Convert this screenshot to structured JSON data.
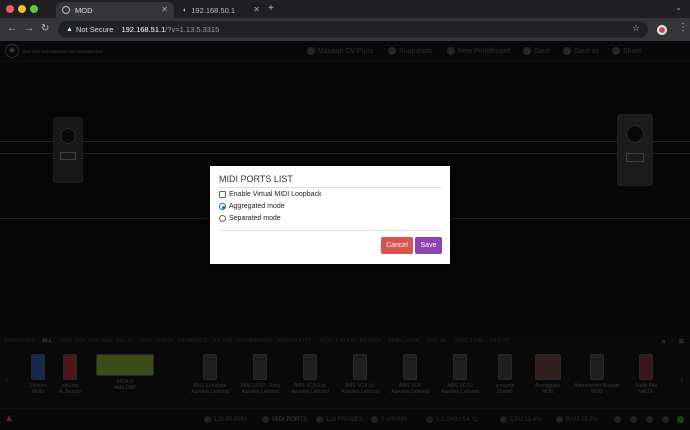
{
  "browser": {
    "tabs": [
      {
        "title": "MOD",
        "active": true
      },
      {
        "title": "192.168.50.1",
        "active": false
      }
    ],
    "address": {
      "security_label": "Not Secure",
      "host": "192.168.51.1",
      "path": "/?v=1.13.5.3315"
    }
  },
  "app": {
    "toolbar": {
      "items": [
        "Manage CV Ports",
        "Snapshots",
        "New Pedalboard",
        "Save",
        "Save as",
        "Share"
      ]
    },
    "categories": [
      "FAVORITES",
      "ALL",
      "CONTROL VOLTAGE",
      "DELAY",
      "DISTORTION",
      "DYNAMICS",
      "FILTER",
      "GENERATOR",
      "MIDI UTILITY",
      "MODULATION",
      "REVERB",
      "SIMULATOR",
      "SPATIAL",
      "SPECTRAL",
      "UTILITY"
    ],
    "selected_category": "ALL",
    "plugins": [
      {
        "name": "2Voices",
        "author": "MOD"
      },
      {
        "name": "abGate",
        "author": "A. Bruzzo"
      },
      {
        "name": "AIDA-X",
        "author": "Aida DSP"
      },
      {
        "name": "AMS Envelope",
        "author": "Aurelien Leblond"
      },
      {
        "name": "AMS LFO2 - Freq",
        "author": "Aurelien Leblond"
      },
      {
        "name": "AMS VCA Exp",
        "author": "Aurelien Leblond"
      },
      {
        "name": "AMS VCA Lin",
        "author": "Aurelien Leblond"
      },
      {
        "name": "AMS VCF",
        "author": "Aurelien Leblond"
      },
      {
        "name": "AMS VCO2",
        "author": "Aurelien Leblond"
      },
      {
        "name": "amsynth",
        "author": "Dowell"
      },
      {
        "name": "Arpeggiator",
        "author": "MOD"
      },
      {
        "name": "Attenuverter Booster",
        "author": "MOD"
      },
      {
        "name": "Audio File",
        "author": "falkTX"
      }
    ],
    "status": {
      "bpm": "120.00 BPM",
      "midi_ports": "MIDI PORTS",
      "frames": "128 FRAMES",
      "xruns": "0 XRUNS",
      "clock": "1.3 GHz / 54 °C",
      "cpu": "CPU 10.4%",
      "ram": "RAM 19.9%"
    }
  },
  "modal": {
    "title": "MIDI PORTS LIST",
    "options": [
      {
        "label": "Enable Virtual MIDI Loopback",
        "type": "checkbox",
        "checked": false
      },
      {
        "label": "Aggregated mode",
        "type": "radio",
        "checked": true
      },
      {
        "label": "Separated mode",
        "type": "radio",
        "checked": false
      }
    ],
    "cancel_label": "Cancel",
    "save_label": "Save"
  },
  "colors": {
    "cancel": "#d9534f",
    "save": "#8e44ad",
    "cable": "#5a2a5e"
  }
}
